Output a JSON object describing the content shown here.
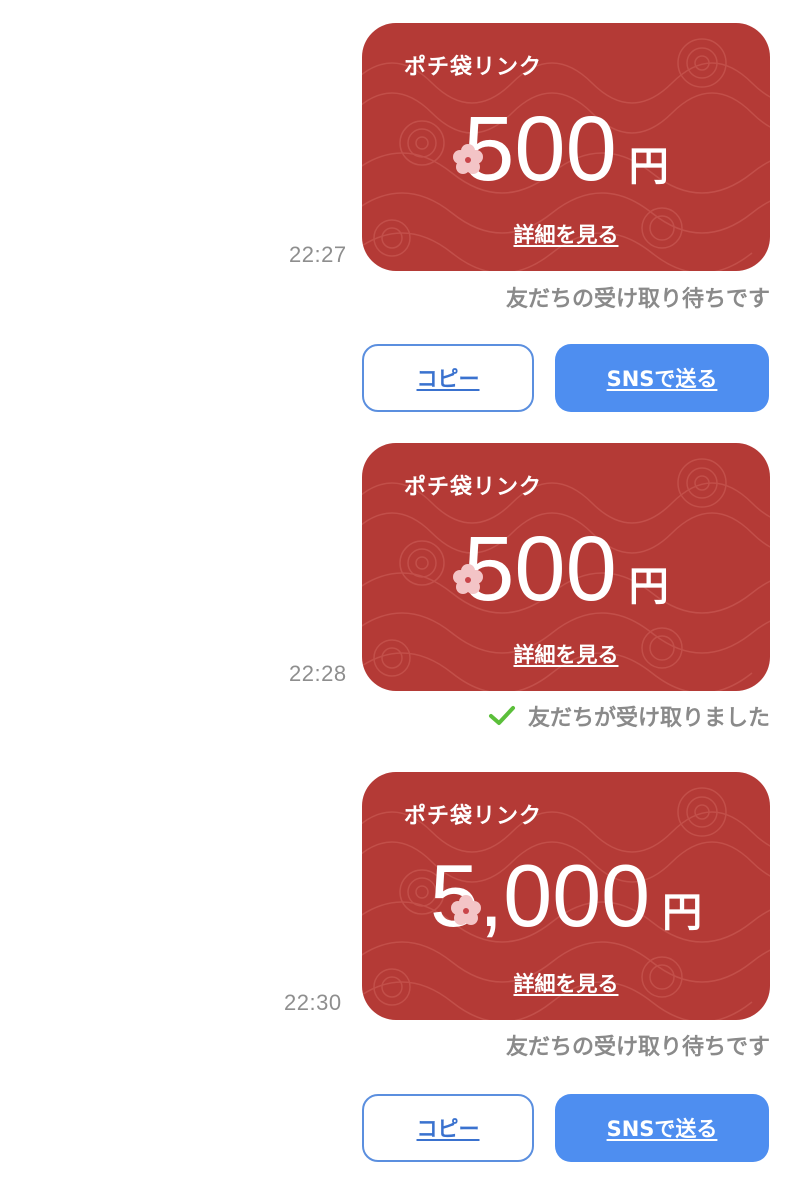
{
  "messages": [
    {
      "timestamp": "22:27",
      "card": {
        "title": "ポチ袋リンク",
        "amount": "500",
        "currency": "円",
        "details_link": "詳細を見る"
      },
      "status": "友だちの受け取り待ちです",
      "buttons": {
        "copy": "コピー",
        "sns": "SNSで送る"
      }
    },
    {
      "timestamp": "22:28",
      "card": {
        "title": "ポチ袋リンク",
        "amount": "500",
        "currency": "円",
        "details_link": "詳細を見る"
      },
      "status": "友だちが受け取りました",
      "status_icon": "checkmark-icon"
    },
    {
      "timestamp": "22:30",
      "card": {
        "title": "ポチ袋リンク",
        "amount": "5,000",
        "currency": "円",
        "details_link": "詳細を見る"
      },
      "status": "友だちの受け取り待ちです",
      "buttons": {
        "copy": "コピー",
        "sns": "SNSで送る"
      }
    }
  ],
  "colors": {
    "card_red": "#b43a36",
    "card_pattern": "#c9605a",
    "button_blue": "#4e8ef0",
    "link_blue": "#3a72cf",
    "status_gray": "#8a8a8a",
    "check_green": "#5bbf3a"
  }
}
